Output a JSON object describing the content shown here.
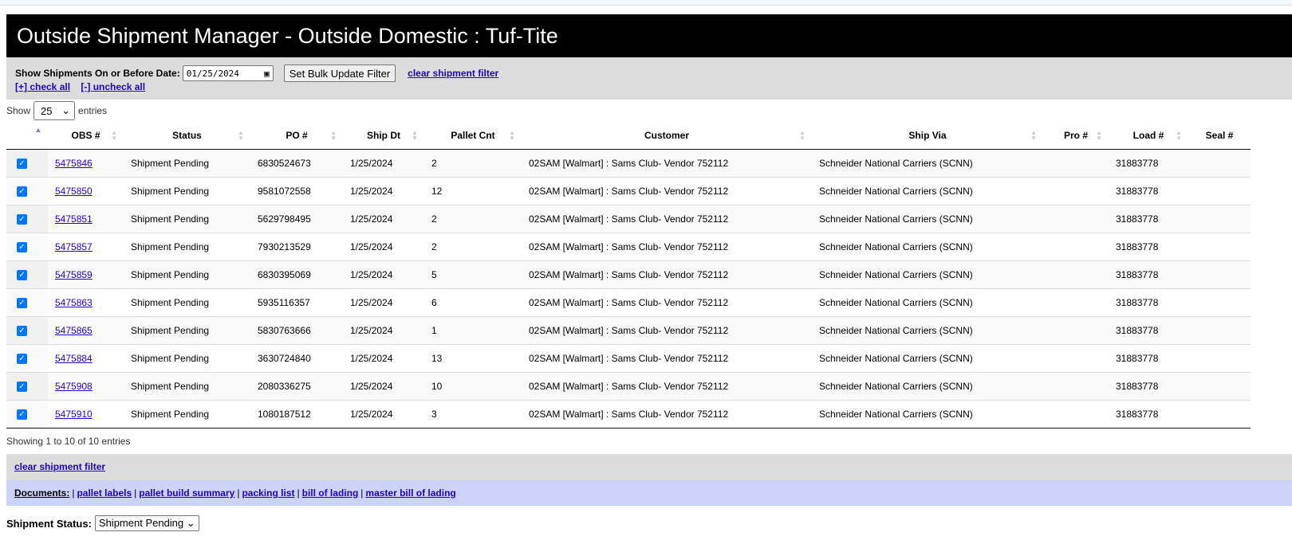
{
  "title": "Outside Shipment Manager - Outside Domestic : Tuf-Tite",
  "filter": {
    "date_label": "Show Shipments On or Before Date:",
    "date_value": "01/25/2024",
    "bulk_button": "Set Bulk Update Filter",
    "clear_link": "clear shipment filter",
    "check_all": "[+] check all",
    "uncheck_all": "[-] uncheck all"
  },
  "length": {
    "show": "Show",
    "value": "25",
    "entries": "entries"
  },
  "columns": [
    "",
    "OBS #",
    "Status",
    "PO #",
    "Ship Dt",
    "Pallet Cnt",
    "Customer",
    "Ship Via",
    "Pro #",
    "Load #",
    "Seal #"
  ],
  "rows": [
    {
      "checked": true,
      "obs": "5475846",
      "status": "Shipment Pending",
      "po": "6830524673",
      "ship_dt": "1/25/2024",
      "pallets": "2",
      "customer": "02SAM [Walmart] : Sams Club- Vendor 752112",
      "ship_via": "Schneider National Carriers (SCNN)",
      "pro": "",
      "load": "31883778",
      "seal": ""
    },
    {
      "checked": true,
      "obs": "5475850",
      "status": "Shipment Pending",
      "po": "9581072558",
      "ship_dt": "1/25/2024",
      "pallets": "12",
      "customer": "02SAM [Walmart] : Sams Club- Vendor 752112",
      "ship_via": "Schneider National Carriers (SCNN)",
      "pro": "",
      "load": "31883778",
      "seal": ""
    },
    {
      "checked": true,
      "obs": "5475851",
      "status": "Shipment Pending",
      "po": "5629798495",
      "ship_dt": "1/25/2024",
      "pallets": "2",
      "customer": "02SAM [Walmart] : Sams Club- Vendor 752112",
      "ship_via": "Schneider National Carriers (SCNN)",
      "pro": "",
      "load": "31883778",
      "seal": ""
    },
    {
      "checked": true,
      "obs": "5475857",
      "status": "Shipment Pending",
      "po": "7930213529",
      "ship_dt": "1/25/2024",
      "pallets": "2",
      "customer": "02SAM [Walmart] : Sams Club- Vendor 752112",
      "ship_via": "Schneider National Carriers (SCNN)",
      "pro": "",
      "load": "31883778",
      "seal": ""
    },
    {
      "checked": true,
      "obs": "5475859",
      "status": "Shipment Pending",
      "po": "6830395069",
      "ship_dt": "1/25/2024",
      "pallets": "5",
      "customer": "02SAM [Walmart] : Sams Club- Vendor 752112",
      "ship_via": "Schneider National Carriers (SCNN)",
      "pro": "",
      "load": "31883778",
      "seal": ""
    },
    {
      "checked": true,
      "obs": "5475863",
      "status": "Shipment Pending",
      "po": "5935116357",
      "ship_dt": "1/25/2024",
      "pallets": "6",
      "customer": "02SAM [Walmart] : Sams Club- Vendor 752112",
      "ship_via": "Schneider National Carriers (SCNN)",
      "pro": "",
      "load": "31883778",
      "seal": ""
    },
    {
      "checked": true,
      "obs": "5475865",
      "status": "Shipment Pending",
      "po": "5830763666",
      "ship_dt": "1/25/2024",
      "pallets": "1",
      "customer": "02SAM [Walmart] : Sams Club- Vendor 752112",
      "ship_via": "Schneider National Carriers (SCNN)",
      "pro": "",
      "load": "31883778",
      "seal": ""
    },
    {
      "checked": true,
      "obs": "5475884",
      "status": "Shipment Pending",
      "po": "3630724840",
      "ship_dt": "1/25/2024",
      "pallets": "13",
      "customer": "02SAM [Walmart] : Sams Club- Vendor 752112",
      "ship_via": "Schneider National Carriers (SCNN)",
      "pro": "",
      "load": "31883778",
      "seal": ""
    },
    {
      "checked": true,
      "obs": "5475908",
      "status": "Shipment Pending",
      "po": "2080336275",
      "ship_dt": "1/25/2024",
      "pallets": "10",
      "customer": "02SAM [Walmart] : Sams Club- Vendor 752112",
      "ship_via": "Schneider National Carriers (SCNN)",
      "pro": "",
      "load": "31883778",
      "seal": ""
    },
    {
      "checked": true,
      "obs": "5475910",
      "status": "Shipment Pending",
      "po": "1080187512",
      "ship_dt": "1/25/2024",
      "pallets": "3",
      "customer": "02SAM [Walmart] : Sams Club- Vendor 752112",
      "ship_via": "Schneider National Carriers (SCNN)",
      "pro": "",
      "load": "31883778",
      "seal": ""
    }
  ],
  "info": "Showing 1 to 10 of 10 entries",
  "bottom_clear": "clear shipment filter",
  "documents": {
    "label": "Documents:",
    "links": [
      "pallet labels",
      "pallet build summary",
      "packing list",
      "bill of lading",
      "master bill of lading"
    ]
  },
  "shipment_status": {
    "label": "Shipment Status:",
    "value": "Shipment Pending"
  },
  "colors": {
    "title_bg": "#000000",
    "filter_bg": "#dcdcdc",
    "docs_bg": "#ccd3f8",
    "link": "#2200cc",
    "checkbox": "#0075ff"
  }
}
